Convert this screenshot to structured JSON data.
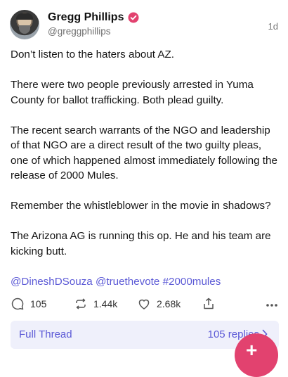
{
  "header": {
    "display_name": "Gregg Phillips",
    "handle": "@greggphillips",
    "time": "1d"
  },
  "post": {
    "paragraphs": [
      "Don’t listen to the haters about AZ.",
      "There were two people previously arrested in Yuma County for ballot trafficking. Both plead guilty.",
      "The recent search warrants of the NGO and leadership of that NGO are a direct result of the two guilty pleas, one of which happened almost immediately following the release of 2000 Mules.",
      "Remember the whistleblower in the movie in shadows?",
      "The Arizona AG is running this op. He and his team are kicking butt."
    ],
    "tags": "@DineshDSouza @truethevote #2000mules"
  },
  "actions": {
    "replies": "105",
    "reposts": "1.44k",
    "likes": "2.68k"
  },
  "thread": {
    "label": "Full Thread",
    "replies": "105 replies"
  },
  "colors": {
    "accent": "#5b59d6",
    "verified": "#e2426f",
    "thread_bg": "#eff0fb"
  },
  "icons": [
    "verified-icon",
    "reply-icon",
    "repost-icon",
    "like-icon",
    "share-icon",
    "more-icon",
    "chevron-right-icon"
  ]
}
